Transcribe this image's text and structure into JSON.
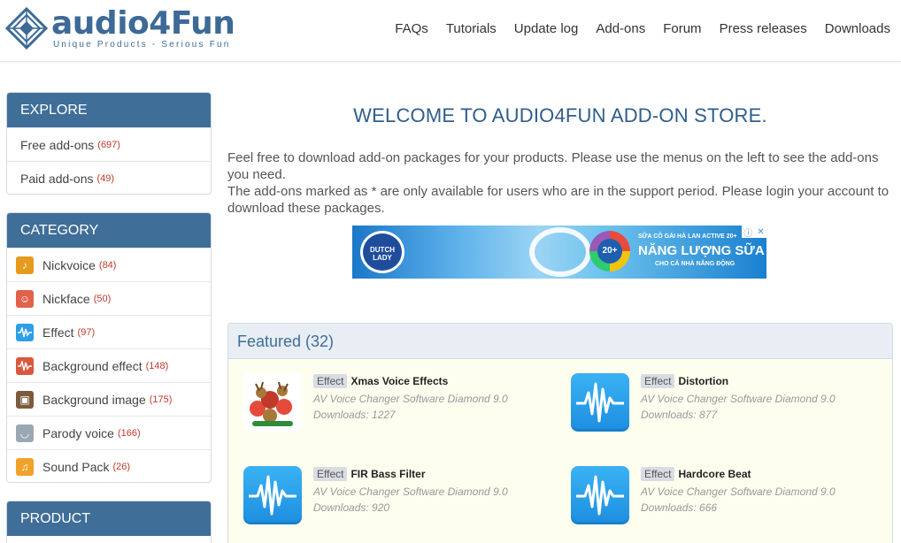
{
  "header": {
    "logo_text": "audio4Fun",
    "tagline": "Unique Products - Serious Fun",
    "nav": [
      "FAQs",
      "Tutorials",
      "Update log",
      "Add-ons",
      "Forum",
      "Press releases",
      "Downloads"
    ]
  },
  "sidebar": {
    "explore": {
      "title": "EXPLORE",
      "items": [
        {
          "label": "Free add-ons",
          "count": "(697)"
        },
        {
          "label": "Paid add-ons",
          "count": "(49)"
        }
      ]
    },
    "category": {
      "title": "CATEGORY",
      "items": [
        {
          "label": "Nickvoice",
          "count": "(84)",
          "icon": "nickvoice-icon",
          "color": "#e69a1e"
        },
        {
          "label": "Nickface",
          "count": "(50)",
          "icon": "nickface-icon",
          "color": "#e0624a"
        },
        {
          "label": "Effect",
          "count": "(97)",
          "icon": "effect-icon",
          "color": "#2d9fe8"
        },
        {
          "label": "Background effect",
          "count": "(148)",
          "icon": "background-effect-icon",
          "color": "#d9583e"
        },
        {
          "label": "Background image",
          "count": "(175)",
          "icon": "background-image-icon",
          "color": "#7a5c3c"
        },
        {
          "label": "Parody voice",
          "count": "(166)",
          "icon": "parody-voice-icon",
          "color": "#9aa7b5"
        },
        {
          "label": "Sound Pack",
          "count": "(26)",
          "icon": "sound-pack-icon",
          "color": "#f0a22a"
        }
      ]
    },
    "product": {
      "title": "PRODUCT"
    }
  },
  "main": {
    "welcome": "WELCOME TO AUDIO4FUN ADD-ON STORE.",
    "intro_1": "Feel free to download add-on packages for your products. Please use the menus on the left to see the add-ons you need.",
    "intro_2": "The add-ons marked as * are only available for users who are in the support period. Please login your account to download these packages."
  },
  "ad": {
    "brand": "DUTCH LADY",
    "badge_number": "20+",
    "small_line": "SỮA CÔ GÁI HÀ LAN ACTIVE 20+",
    "headline": "NĂNG LƯỢNG SỮA",
    "subline": "CHO CẢ NHÀ NĂNG ĐỘNG"
  },
  "featured": {
    "title": "Featured (32)",
    "items": [
      {
        "tag": "Effect",
        "name": "Xmas Voice Effects",
        "product": "AV Voice Changer Software Diamond 9.0",
        "downloads": "Downloads: 1227",
        "thumb": "xmas"
      },
      {
        "tag": "Effect",
        "name": "Distortion",
        "product": "AV Voice Changer Software Diamond 9.0",
        "downloads": "Downloads: 877",
        "thumb": "wave"
      },
      {
        "tag": "Effect",
        "name": "FIR Bass Filter",
        "product": "AV Voice Changer Software Diamond 9.0",
        "downloads": "Downloads: 920",
        "thumb": "wave"
      },
      {
        "tag": "Effect",
        "name": "Hardcore Beat",
        "product": "AV Voice Changer Software Diamond 9.0",
        "downloads": "Downloads: 666",
        "thumb": "wave"
      }
    ]
  }
}
